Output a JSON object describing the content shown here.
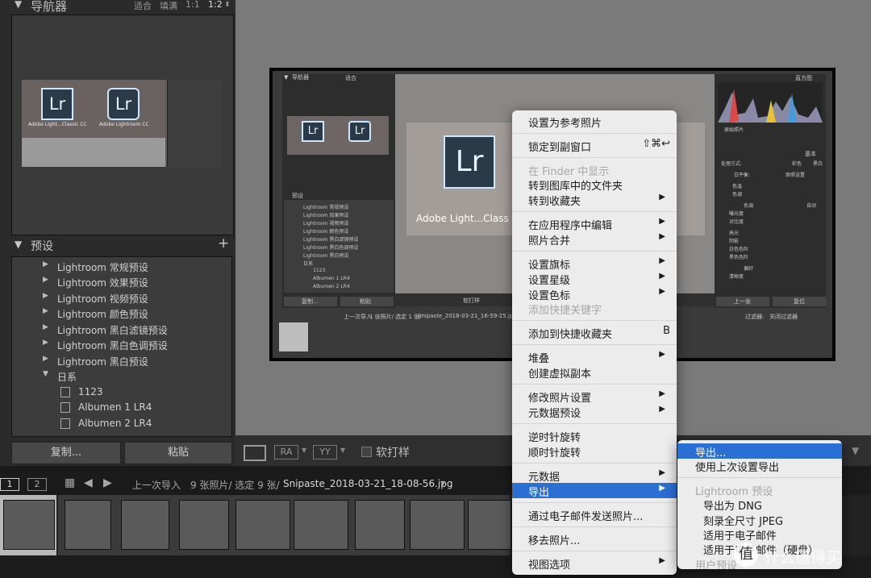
{
  "navigator": {
    "title": "导航器",
    "zoom_options": [
      "适合",
      "填满",
      "1:1",
      "1:2"
    ]
  },
  "thumbnail": {
    "app1_label": "Adobe Light...Classic CC",
    "app2_label": "Adobe Lightroom CC",
    "logo": "Lr"
  },
  "presets": {
    "title": "预设",
    "add": "+",
    "items": [
      {
        "label": "Lightroom 常规预设"
      },
      {
        "label": "Lightroom 效果预设"
      },
      {
        "label": "Lightroom 视频预设"
      },
      {
        "label": "Lightroom 颜色预设"
      },
      {
        "label": "Lightroom 黑白滤镜预设"
      },
      {
        "label": "Lightroom 黑白色调预设"
      },
      {
        "label": "Lightroom 黑白预设"
      },
      {
        "label": "日系"
      }
    ],
    "sub_items": [
      "1123",
      "Albumen 1 LR4",
      "Albumen 2 LR4"
    ]
  },
  "buttons": {
    "copy": "复制...",
    "paste": "粘贴"
  },
  "toolbar": {
    "soft_proof": "软打样"
  },
  "filmbar": {
    "page1": "1",
    "page2": "2",
    "source": "上一次导入",
    "count": "9 张照片/ 选定 9 张/",
    "filename": "Snipaste_2018-03-21_18-08-56.jpg"
  },
  "inner": {
    "navigator": "导航器",
    "fit": "适合",
    "presets": "预设",
    "preset_items": [
      "Lightroom 常规预设",
      "Lightroom 效果预设",
      "Lightroom 视频预设",
      "Lightroom 颜色预设",
      "Lightroom 黑白滤镜预设",
      "Lightroom 黑白色调预设",
      "Lightroom 黑白预设",
      "日系",
      "1123",
      "Albumen 1 LR4",
      "Albumen 2 LR4"
    ],
    "copy": "复制...",
    "paste": "粘贴",
    "soft_proof": "软打样",
    "histogram": "直方图",
    "original_photo": "原始照片",
    "basic": "基本",
    "treatment": "处理方式:",
    "color": "彩色",
    "bw": "黑白",
    "wb": "白平衡:",
    "wb_value": "原照设置",
    "temp": "色温",
    "tint": "色调",
    "tone": "色调",
    "auto": "自动",
    "exposure": "曝光度",
    "contrast": "对比度",
    "highlights": "高光",
    "shadows": "阴影",
    "whites": "白色色阶",
    "blacks": "黑色色阶",
    "presence": "偏好",
    "clarity": "清晰度",
    "prev": "上一张",
    "reset": "复位",
    "filter": "过滤器:",
    "filter_value": "关闭过滤器",
    "source": "上一次导入",
    "count": "1 张照片/ 选定 1 张/",
    "filename": "Snipaste_2018-03-21_16-59-25.jpg",
    "big_label": "Adobe Light...Class"
  },
  "context_menu": {
    "items": [
      {
        "label": "设置为参考照片"
      },
      {
        "label": "锁定到副窗口",
        "shortcut": "⇧⌘↩"
      },
      {
        "label": "在 Finder 中显示",
        "disabled": true
      },
      {
        "label": "转到图库中的文件夹"
      },
      {
        "label": "转到收藏夹",
        "submenu": true
      },
      {
        "label": "在应用程序中编辑",
        "submenu": true
      },
      {
        "label": "照片合并",
        "submenu": true
      },
      {
        "label": "设置旗标",
        "submenu": true
      },
      {
        "label": "设置星级",
        "submenu": true
      },
      {
        "label": "设置色标",
        "submenu": true
      },
      {
        "label": "添加快捷关键字",
        "disabled": true
      },
      {
        "label": "添加到快捷收藏夹",
        "shortcut": "B"
      },
      {
        "label": "堆叠",
        "submenu": true
      },
      {
        "label": "创建虚拟副本"
      },
      {
        "label": "修改照片设置",
        "submenu": true
      },
      {
        "label": "元数据预设",
        "submenu": true
      },
      {
        "label": "逆时针旋转"
      },
      {
        "label": "顺时针旋转"
      },
      {
        "label": "元数据",
        "submenu": true
      },
      {
        "label": "导出",
        "submenu": true,
        "highlighted": true
      },
      {
        "label": "通过电子邮件发送照片..."
      },
      {
        "label": "移去照片..."
      },
      {
        "label": "视图选项",
        "submenu": true
      }
    ]
  },
  "export_submenu": {
    "items": [
      {
        "label": "导出...",
        "highlighted": true
      },
      {
        "label": "使用上次设置导出"
      },
      {
        "label": "Lightroom 预设",
        "disabled": true
      },
      {
        "label": "导出为 DNG"
      },
      {
        "label": "刻录全尺寸 JPEG"
      },
      {
        "label": "适用于电子邮件"
      },
      {
        "label": "适用于电子邮件（硬盘）"
      },
      {
        "label": "用户预设",
        "disabled": true
      }
    ]
  },
  "watermark": "值 什么值得买",
  "colors": {
    "highlight": "#2c6fd4",
    "menu_bg": "#ececec",
    "panel_bg": "#2b2b2b",
    "lr_blue": "#2b3a48"
  }
}
